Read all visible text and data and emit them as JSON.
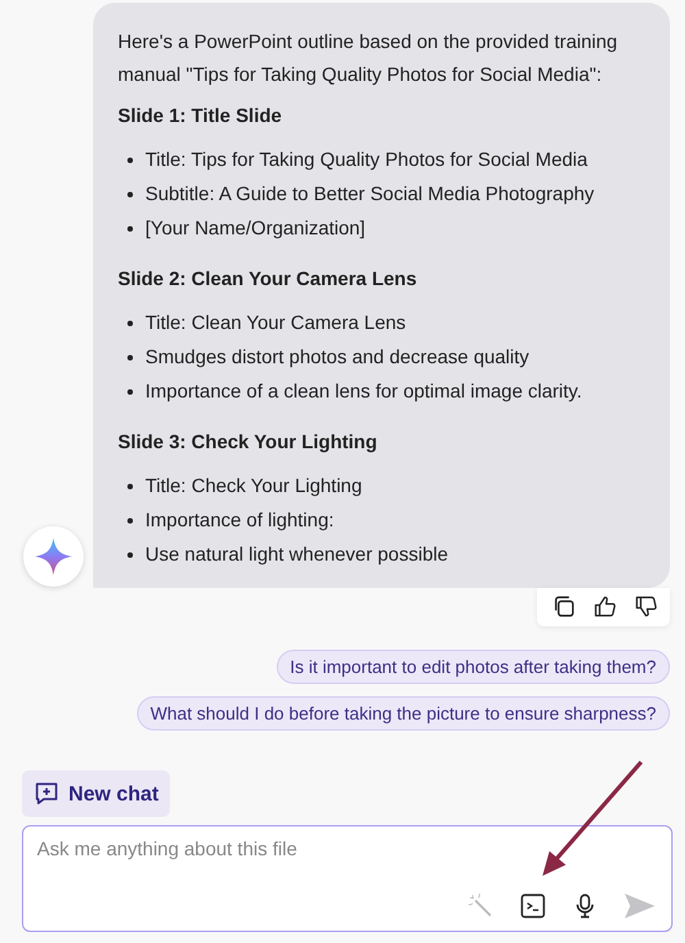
{
  "message": {
    "intro": "Here's a PowerPoint outline based on the provided training manual \"Tips for Taking Quality Photos for Social Media\":",
    "sections": [
      {
        "heading": "Slide 1: Title Slide",
        "bullets": [
          "Title: Tips for Taking Quality Photos for Social Media",
          "Subtitle: A Guide to Better Social Media Photography",
          "[Your Name/Organization]"
        ]
      },
      {
        "heading": "Slide 2: Clean Your Camera Lens",
        "bullets": [
          "Title: Clean Your Camera Lens",
          "Smudges distort photos and decrease quality",
          "Importance of a clean lens for optimal image clarity."
        ]
      },
      {
        "heading": "Slide 3: Check Your Lighting",
        "bullets": [
          "Title: Check Your Lighting",
          "Importance of lighting:",
          "Use natural light whenever possible"
        ]
      }
    ]
  },
  "suggestions": [
    "Is it important to edit photos after taking them?",
    "What should I do before taking the picture to ensure sharpness?"
  ],
  "new_chat": {
    "label": "New chat"
  },
  "composer": {
    "placeholder": "Ask me anything about this file"
  }
}
